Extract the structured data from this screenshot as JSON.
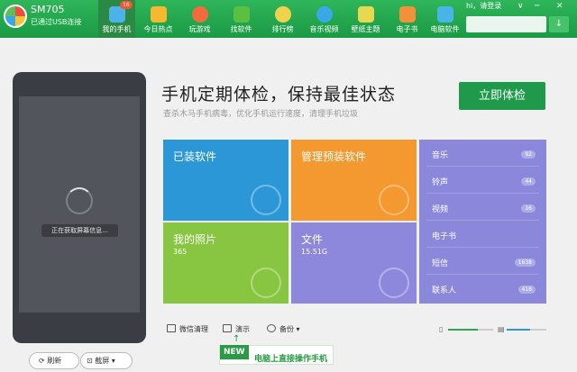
{
  "device": {
    "name": "SM705",
    "connection": "已通过USB连接"
  },
  "nav": [
    {
      "label": "我的手机",
      "icon": "phone-icon",
      "active": true,
      "color": "#4db1ea"
    },
    {
      "label": "今日热点",
      "icon": "star-icon",
      "color": "#f5b82e"
    },
    {
      "label": "玩游戏",
      "icon": "gamepad-icon",
      "color": "#f36b3d"
    },
    {
      "label": "找软件",
      "icon": "app-store-icon",
      "color": "#5bbf42"
    },
    {
      "label": "排行榜",
      "icon": "medal-icon",
      "color": "#f0d24c"
    },
    {
      "label": "音乐视频",
      "icon": "play-icon",
      "color": "#3aa7e6"
    },
    {
      "label": "壁纸主题",
      "icon": "wallpaper-icon",
      "color": "#e7d84e"
    },
    {
      "label": "电子书",
      "icon": "book-icon",
      "color": "#f2913a"
    },
    {
      "label": "电脑软件",
      "icon": "computer-apps-icon",
      "color": "#49b4e8"
    }
  ],
  "nav_badge": "16",
  "login": "hi，请登录",
  "window_controls": [
    "∨",
    "─",
    "✕"
  ],
  "phone": {
    "loading_text": "正在获取屏幕信息...",
    "refresh": "刷新",
    "screenshot": "截屏"
  },
  "header": {
    "title": "手机定期体检，保持最佳状态",
    "subtitle": "查杀木马手机病毒，优化手机运行速度，清理手机垃圾",
    "check_button": "立即体检"
  },
  "tiles": {
    "apps": {
      "title": "已装软件"
    },
    "preinstalled": {
      "title": "管理预装软件"
    },
    "photos": {
      "title": "我的照片",
      "value": "365"
    },
    "files": {
      "title": "文件",
      "value": "15.51G"
    }
  },
  "media": [
    {
      "label": "音乐",
      "count": "92"
    },
    {
      "label": "铃声",
      "count": "44"
    },
    {
      "label": "视频",
      "count": "16"
    },
    {
      "label": "电子书",
      "count": ""
    },
    {
      "label": "短信",
      "count": "1638"
    },
    {
      "label": "联系人",
      "count": "418"
    }
  ],
  "actions": {
    "wechat": "微信清理",
    "demo": "演示",
    "backup": "备份"
  },
  "promo": {
    "tag": "NEW",
    "text": "电脑上直接操作手机"
  },
  "storage": {
    "phone_used": 0.65,
    "sd_used": 0.6
  },
  "colors": {
    "topbar": "#1fa24a",
    "accent": "#1e9a4a",
    "blue_tile": "#2c97d6",
    "orange_tile": "#f3992f",
    "green_tile": "#88c540",
    "purple_tile": "#8d88dc"
  }
}
